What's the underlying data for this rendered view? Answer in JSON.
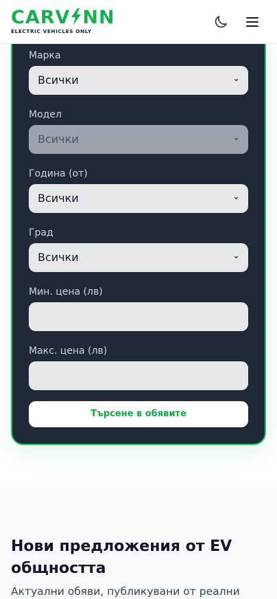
{
  "brand": {
    "name_left": "CARV",
    "name_right": "NN",
    "tagline": "ELECTRIC VEHICLES ONLY",
    "color": "#16b04f"
  },
  "header": {
    "theme_toggle_icon": "moon-icon",
    "menu_icon": "hamburger-menu-icon"
  },
  "filters": {
    "make": {
      "label": "Марка",
      "value": "Всички"
    },
    "model": {
      "label": "Модел",
      "value": "Всички",
      "disabled": true
    },
    "year_from": {
      "label": "Година (от)",
      "value": "Всички"
    },
    "city": {
      "label": "Град",
      "value": "Всички"
    },
    "min_price": {
      "label": "Мин. цена (лв)",
      "value": ""
    },
    "max_price": {
      "label": "Макс. цена (лв)",
      "value": ""
    },
    "submit_label": "Търсене в обявите"
  },
  "community": {
    "title": "Нови предложения от EV общността",
    "subtitle": "Актуални обяви, публикувани от реални"
  },
  "colors": {
    "card_bg": "#1f2937",
    "card_border": "#22c55e",
    "accent": "#16a34a"
  }
}
